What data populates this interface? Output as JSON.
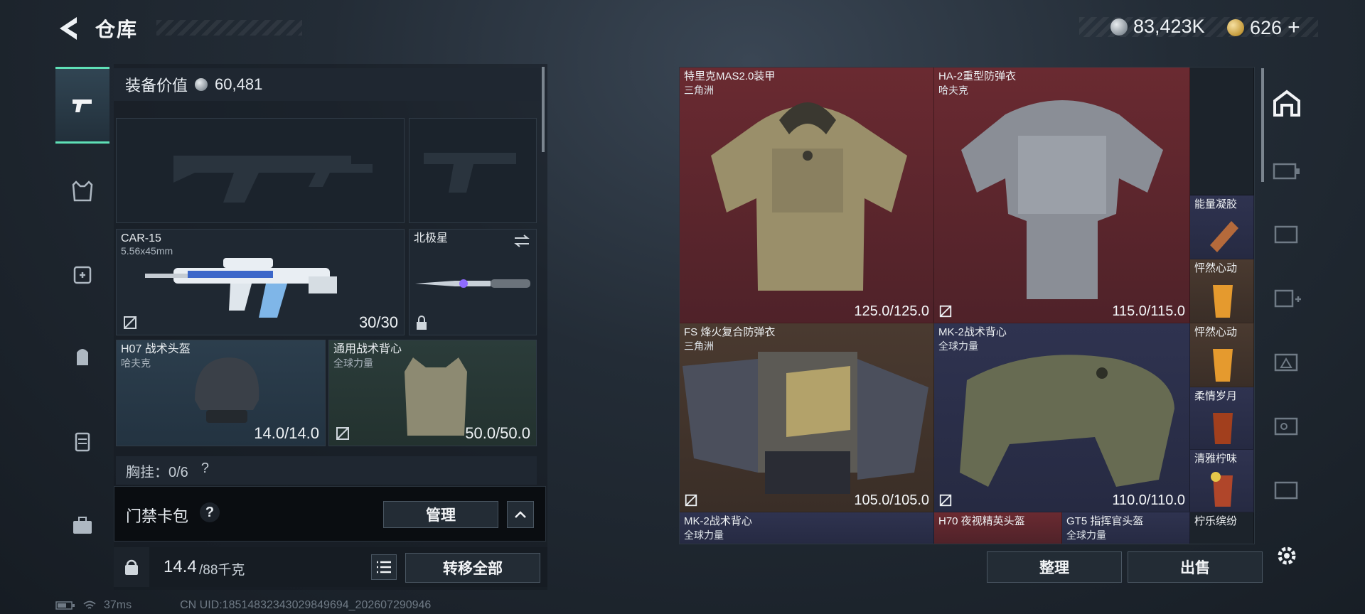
{
  "header": {
    "title": "仓库",
    "silver_amount": "83,423K",
    "gold_amount": "626",
    "gold_plus": "+"
  },
  "equipment": {
    "value_label": "装备价值",
    "value": "60,481",
    "primary_weapon": {
      "name": "CAR-15",
      "caliber": "5.56x45mm",
      "ammo": "30/30"
    },
    "melee": {
      "name": "北极星"
    },
    "helmet": {
      "name": "H07 战术头盔",
      "maker": "哈夫克",
      "durability": "14.0/14.0"
    },
    "vest": {
      "name": "通用战术背心",
      "maker": "全球力量",
      "durability": "50.0/50.0"
    },
    "chest_rig_label": "胸挂：0/6",
    "chest_rig_help": "?"
  },
  "keycard": {
    "label": "门禁卡包",
    "help": "?",
    "manage_label": "管理"
  },
  "weight": {
    "current": "14.4",
    "max": "/88千克",
    "transfer_all_label": "转移全部"
  },
  "inventory": {
    "items": [
      {
        "name": "特里克MAS2.0装甲",
        "maker": "三角洲",
        "durability": "125.0/125.0"
      },
      {
        "name": "HA-2重型防弹衣",
        "maker": "哈夫克",
        "durability": "115.0/115.0"
      },
      {
        "name": "FS 烽火复合防弹衣",
        "maker": "三角洲",
        "durability": "105.0/105.0"
      },
      {
        "name": "MK-2战术背心",
        "maker": "全球力量",
        "durability": "110.0/110.0"
      },
      {
        "name": "MK-2战术背心",
        "maker": "全球力量"
      },
      {
        "name": "H70 夜视精英头盔",
        "maker": ""
      },
      {
        "name": "GT5 指挥官头盔",
        "maker": "全球力量"
      }
    ],
    "side_items": [
      "能量凝胶",
      "怦然心动",
      "怦然心动",
      "柔情岁月",
      "清雅柠味",
      "柠乐缤纷"
    ],
    "sort_label": "整理",
    "sell_label": "出售"
  },
  "status": {
    "ping": "37ms",
    "uid": "CN UID:18514832343029849694_202607290946"
  },
  "colors": {
    "accent": "#5fe0b6",
    "rarity_red": "#6a2a31",
    "rarity_purple": "#2f3350",
    "rarity_gold": "#4a3a30"
  }
}
